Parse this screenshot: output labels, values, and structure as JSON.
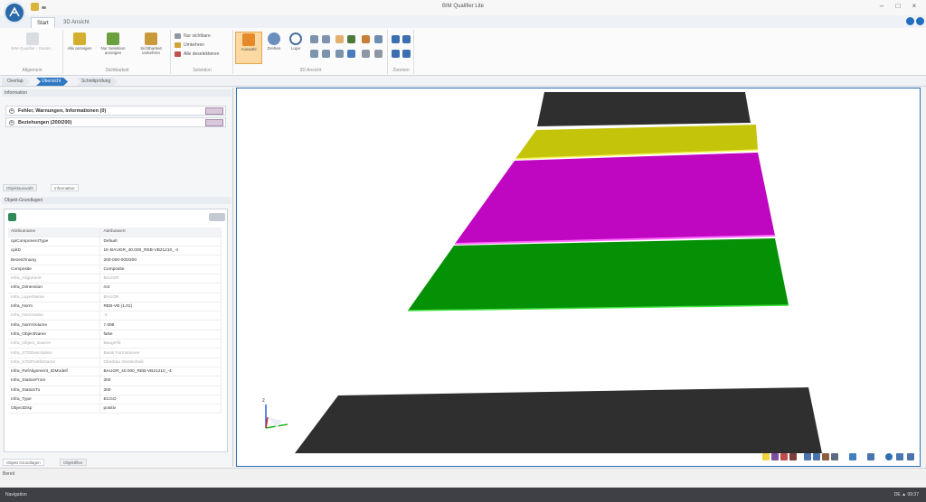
{
  "window": {
    "title": "BIM Qualifier Lite"
  },
  "tabs": [
    {
      "label": "Start"
    },
    {
      "label": "3D Ansicht"
    }
  ],
  "ribbon": {
    "groups": [
      {
        "label": "Allgemein"
      },
      {
        "label": "Sichtbarkeit"
      },
      {
        "label": "Selektion"
      },
      {
        "label": "3D Ansicht"
      },
      {
        "label": "Zoomen"
      }
    ],
    "buttons": {
      "grid_disabled": "BIM-Qualifier - Raster...",
      "alle_anzeigen": "Alle anzeigen",
      "nur_selektion": "Nur Selektion anzeigen",
      "sichtbarkeit": "Sichtbarkeit umkehren",
      "nur_sichtbare": "Nur sichtbare",
      "umkehren": "Umkehren",
      "alle_deselektieren": "Alle deselektieren",
      "auswahl": "Auswahl",
      "drehen": "Drehen",
      "lupe": "Lupe"
    }
  },
  "breadcrumb": [
    "Overlap",
    "Übersicht",
    "Schnittprüfung"
  ],
  "left": {
    "info_header": "Information",
    "rows": [
      "Fehler, Warnungen, Informationen (0)",
      "Beziehungen (200/200)"
    ],
    "panel_tabs": [
      "Objektauswahl",
      "Information"
    ],
    "props_header": "Objekt-Grundlagen",
    "columns": [
      "Attributname",
      "Attributwert"
    ],
    "props": [
      [
        "cpiComponentType",
        "Default"
      ],
      [
        "cpiID",
        "1K-BAUGR_40.000_REB-VB21210_-4"
      ],
      [
        "Bezeichnung",
        "200-000-000/200"
      ],
      [
        "Composite",
        "Composite"
      ],
      [
        "Infra_Alignment",
        "BAUGR"
      ],
      [
        "Infra_Dimension",
        "m3"
      ],
      [
        "Infra_LayerName",
        "BAUGR"
      ],
      [
        "Infra_Norm",
        "REB-VB (1.01)"
      ],
      [
        "Infra_NormValue",
        "-4"
      ],
      [
        "Infra_NormVolume",
        "7.088"
      ],
      [
        "Infra_ObjectName",
        "false"
      ],
      [
        "Infra_Object_Source",
        "BaugrFill"
      ],
      [
        "Infra_STDDescription",
        "Basis Formationen"
      ],
      [
        "Infra_STDPostfixName",
        "Oberbau Geotechnik"
      ],
      [
        "Infra_RefAlignment_IDModell",
        "BAUGR_40.000_REB-VB21210_-4"
      ],
      [
        "Infra_StationFrom",
        "300"
      ],
      [
        "Infra_StationTo",
        "300"
      ],
      [
        "Infra_Type",
        "ECGO"
      ],
      [
        "ObjectDisp",
        "positiv"
      ]
    ],
    "dim_rows": [
      4,
      6,
      8,
      11,
      12,
      13
    ],
    "bottom_tabs": [
      "Objekt Grundlagen",
      "Objektfilter"
    ]
  },
  "viewport": {
    "axis": "z",
    "layers": [
      {
        "name": "dark-top",
        "color": "#2f2f2f"
      },
      {
        "name": "yellow",
        "color": "#c4c40a"
      },
      {
        "name": "magenta",
        "color": "#bf06c0"
      },
      {
        "name": "green",
        "color": "#059105"
      },
      {
        "name": "dark-bottom",
        "color": "#2f2f2f"
      }
    ]
  },
  "status": {
    "text": "Bereit"
  },
  "taskbar": {
    "left": "Navigation",
    "right": "DE  ▲  09:37"
  },
  "colors": {
    "accent": "#2f78c4",
    "active_button": "#fcd9a2"
  }
}
